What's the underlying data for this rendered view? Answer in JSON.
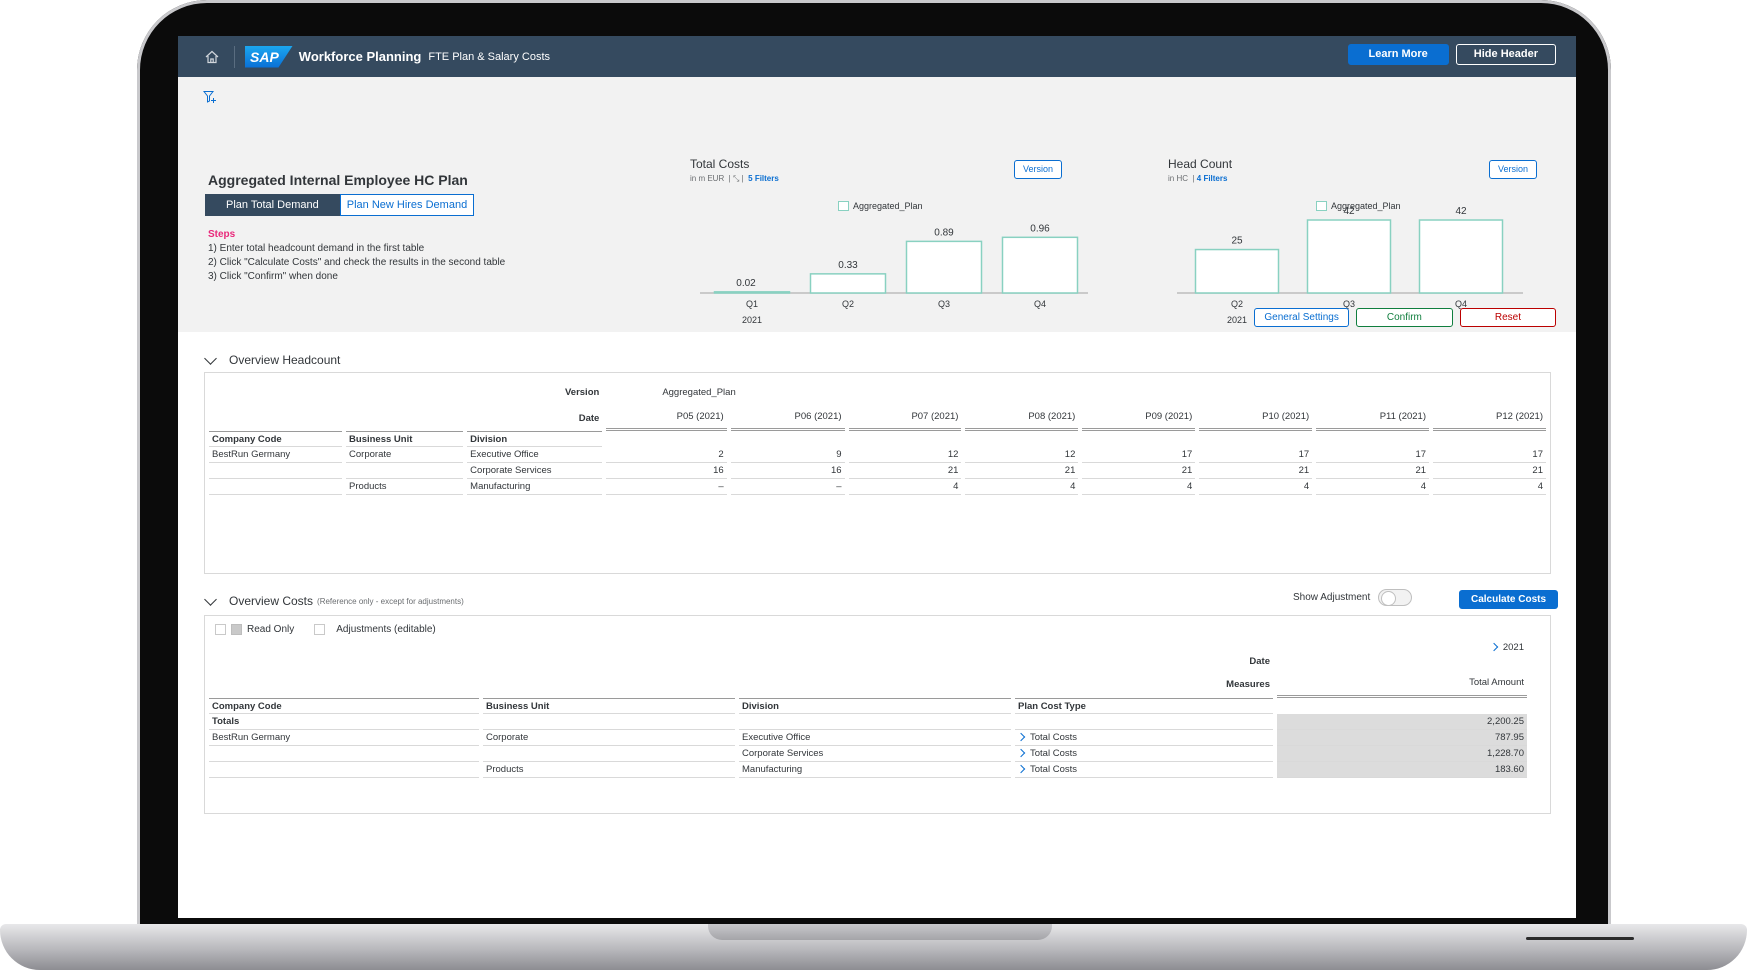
{
  "shell": {
    "logo": "SAP",
    "title": "Workforce Planning",
    "subtitle": "FTE Plan & Salary Costs",
    "learn_more": "Learn More",
    "hide_header": "Hide Header"
  },
  "plan": {
    "title": "Aggregated Internal Employee HC Plan",
    "seg_total": "Plan Total Demand",
    "seg_new": "Plan New Hires Demand",
    "steps_title": "Steps",
    "steps": [
      "1) Enter total headcount demand in the first table",
      "2) Click \"Calculate Costs\" and check the results in the second table",
      "3) Click \"Confirm\" when done"
    ]
  },
  "charts": [
    {
      "title": "Total Costs",
      "unit": "in m EUR",
      "filters": "5 Filters",
      "version_btn": "Version",
      "legend": "Aggregated_Plan",
      "chart_data": {
        "type": "bar",
        "categories": [
          "Q1",
          "Q2",
          "Q3",
          "Q4"
        ],
        "year_label": "2021",
        "values": [
          0.02,
          0.33,
          0.89,
          0.96
        ],
        "labels": [
          "0.02",
          "0.33",
          "0.89",
          "0.96"
        ],
        "series_name": "Aggregated_Plan",
        "ylim": [
          0,
          1
        ]
      }
    },
    {
      "title": "Head Count",
      "unit": "in HC",
      "filters": "4 Filters",
      "version_btn": "Version",
      "legend": "Aggregated_Plan",
      "chart_data": {
        "type": "bar",
        "categories": [
          "Q2",
          "Q3",
          "Q4"
        ],
        "year_label": "2021",
        "values": [
          25,
          42,
          42
        ],
        "labels": [
          "25",
          "42",
          "42"
        ],
        "series_name": "Aggregated_Plan",
        "ylim": [
          0,
          42
        ]
      }
    }
  ],
  "actions": {
    "general_settings": "General Settings",
    "confirm": "Confirm",
    "reset": "Reset"
  },
  "headcount": {
    "title": "Overview Headcount",
    "version_label": "Version",
    "version_value": "Aggregated_Plan",
    "date_label": "Date",
    "periods": [
      "P05 (2021)",
      "P06 (2021)",
      "P07 (2021)",
      "P08 (2021)",
      "P09 (2021)",
      "P10 (2021)",
      "P11 (2021)",
      "P12 (2021)"
    ],
    "columns": [
      "Company Code",
      "Business Unit",
      "Division"
    ],
    "rows": [
      {
        "company": "BestRun Germany",
        "unit": "Corporate",
        "division": "Executive Office",
        "values": [
          "2",
          "9",
          "12",
          "12",
          "17",
          "17",
          "17",
          "17"
        ]
      },
      {
        "company": "",
        "unit": "",
        "division": "Corporate Services",
        "values": [
          "16",
          "16",
          "21",
          "21",
          "21",
          "21",
          "21",
          "21"
        ]
      },
      {
        "company": "",
        "unit": "Products",
        "division": "Manufacturing",
        "values": [
          "–",
          "–",
          "4",
          "4",
          "4",
          "4",
          "4",
          "4"
        ]
      }
    ]
  },
  "costs": {
    "title": "Overview Costs",
    "note": "(Reference only - except for adjustments)",
    "show_adjustment": "Show Adjustment",
    "calculate": "Calculate Costs",
    "legend_readonly": "Read Only",
    "legend_adjust": "Adjustments (editable)",
    "date_label": "Date",
    "date_value": "2021",
    "measures_label": "Measures",
    "measures_value": "Total Amount",
    "columns": [
      "Company Code",
      "Business Unit",
      "Division",
      "Plan Cost Type"
    ],
    "totals_label": "Totals",
    "totals_value": "2,200.25",
    "rows": [
      {
        "company": "BestRun Germany",
        "unit": "Corporate",
        "division": "Executive Office",
        "type": "Total Costs",
        "value": "787.95"
      },
      {
        "company": "",
        "unit": "",
        "division": "Corporate Services",
        "type": "Total Costs",
        "value": "1,228.70"
      },
      {
        "company": "",
        "unit": "Products",
        "division": "Manufacturing",
        "type": "Total Costs",
        "value": "183.60"
      }
    ]
  }
}
